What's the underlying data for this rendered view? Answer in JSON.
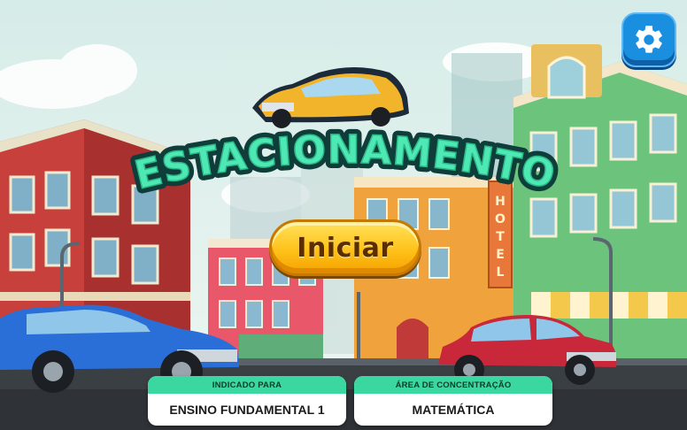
{
  "game": {
    "title": "ESTACIONAMENTO",
    "start_label": "Iniciar",
    "hotel_sign": "HOTEL"
  },
  "info": {
    "level_label": "INDICADO PARA",
    "level_value": "ENSINO FUNDAMENTAL 1",
    "area_label": "ÁREA DE CONCENTRAÇÃO",
    "area_value": "MATEMÁTICA"
  },
  "icons": {
    "settings": "gear-icon"
  },
  "colors": {
    "title_fill": "#4ee8b4",
    "title_outline": "#0f3d3a",
    "button_yellow": "#ffc21a",
    "settings_blue": "#1a8fe0",
    "card_header": "#3ad8a0"
  }
}
